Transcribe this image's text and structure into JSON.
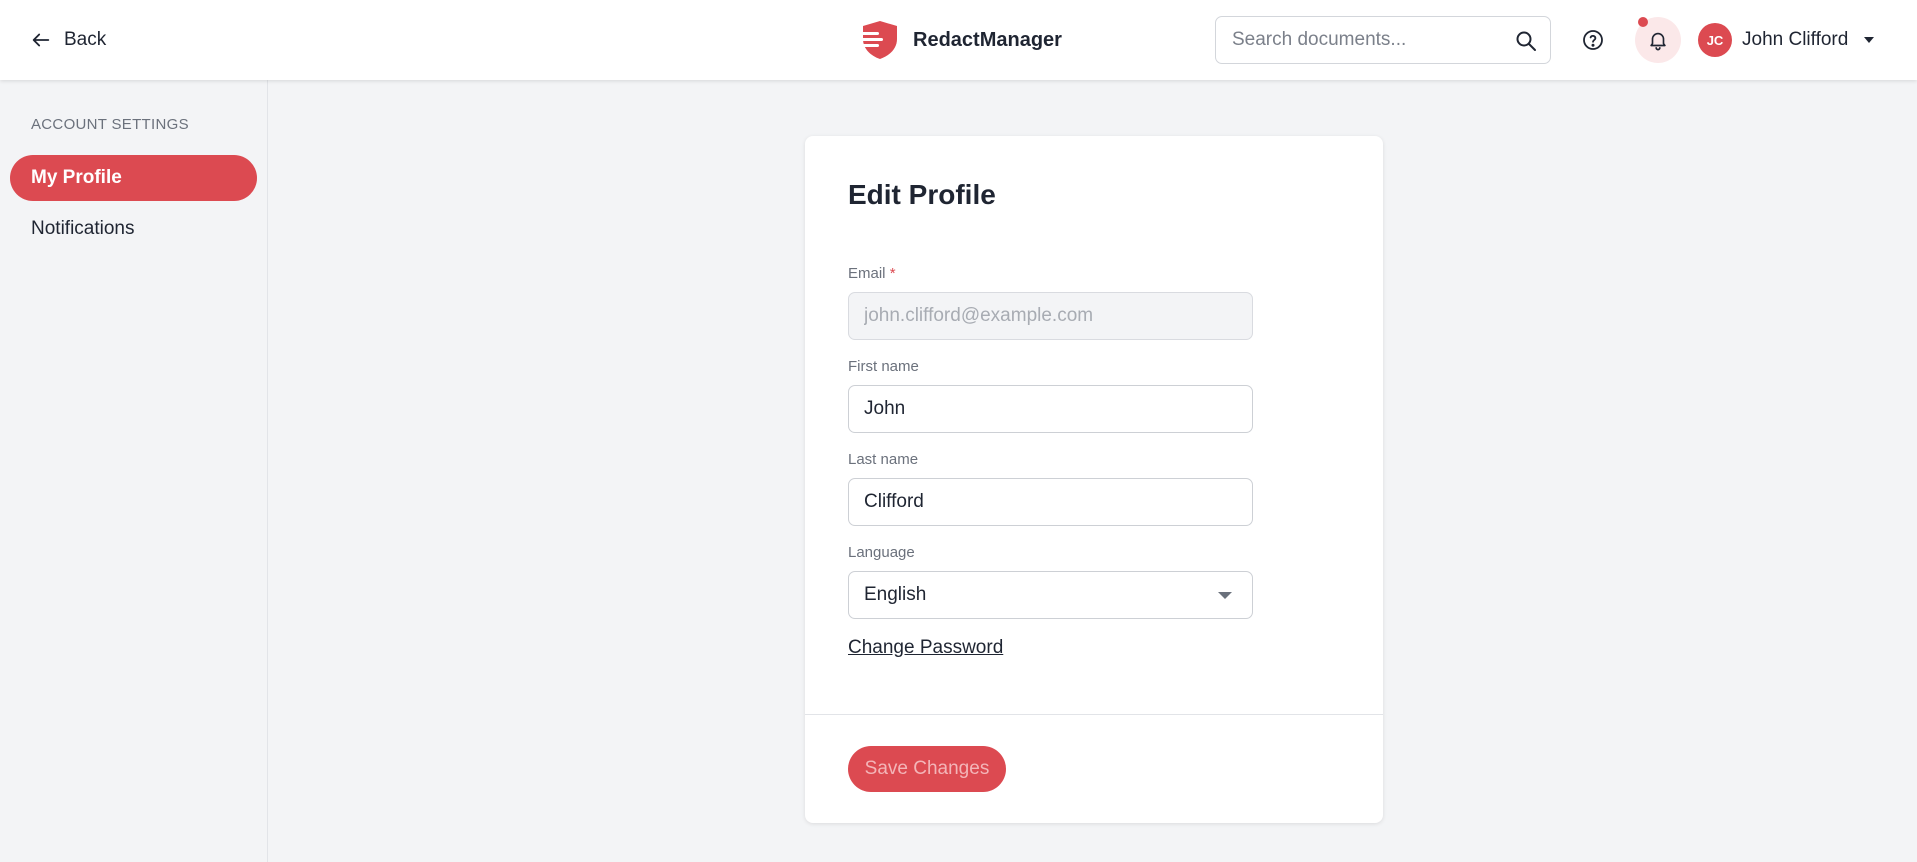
{
  "header": {
    "back_label": "Back",
    "app_name": "RedactManager",
    "search_placeholder": "Search documents...",
    "user": {
      "initials": "JC",
      "name": "John Clifford"
    }
  },
  "sidebar": {
    "heading": "ACCOUNT SETTINGS",
    "items": [
      {
        "label": "My Profile",
        "active": true
      },
      {
        "label": "Notifications",
        "active": false
      }
    ]
  },
  "form": {
    "title": "Edit Profile",
    "email": {
      "label": "Email",
      "required_mark": "*",
      "placeholder": "john.clifford@example.com"
    },
    "first_name": {
      "label": "First name",
      "value": "John"
    },
    "last_name": {
      "label": "Last name",
      "value": "Clifford"
    },
    "language": {
      "label": "Language",
      "value": "English"
    },
    "change_password_label": "Change Password",
    "save_label": "Save Changes"
  },
  "colors": {
    "accent": "#dc4a51",
    "background": "#f3f4f6",
    "text": "#1f2532"
  },
  "icons": [
    "arrow-left-icon",
    "logo-icon",
    "search-icon",
    "help-icon",
    "bell-icon",
    "chevron-down-icon"
  ]
}
